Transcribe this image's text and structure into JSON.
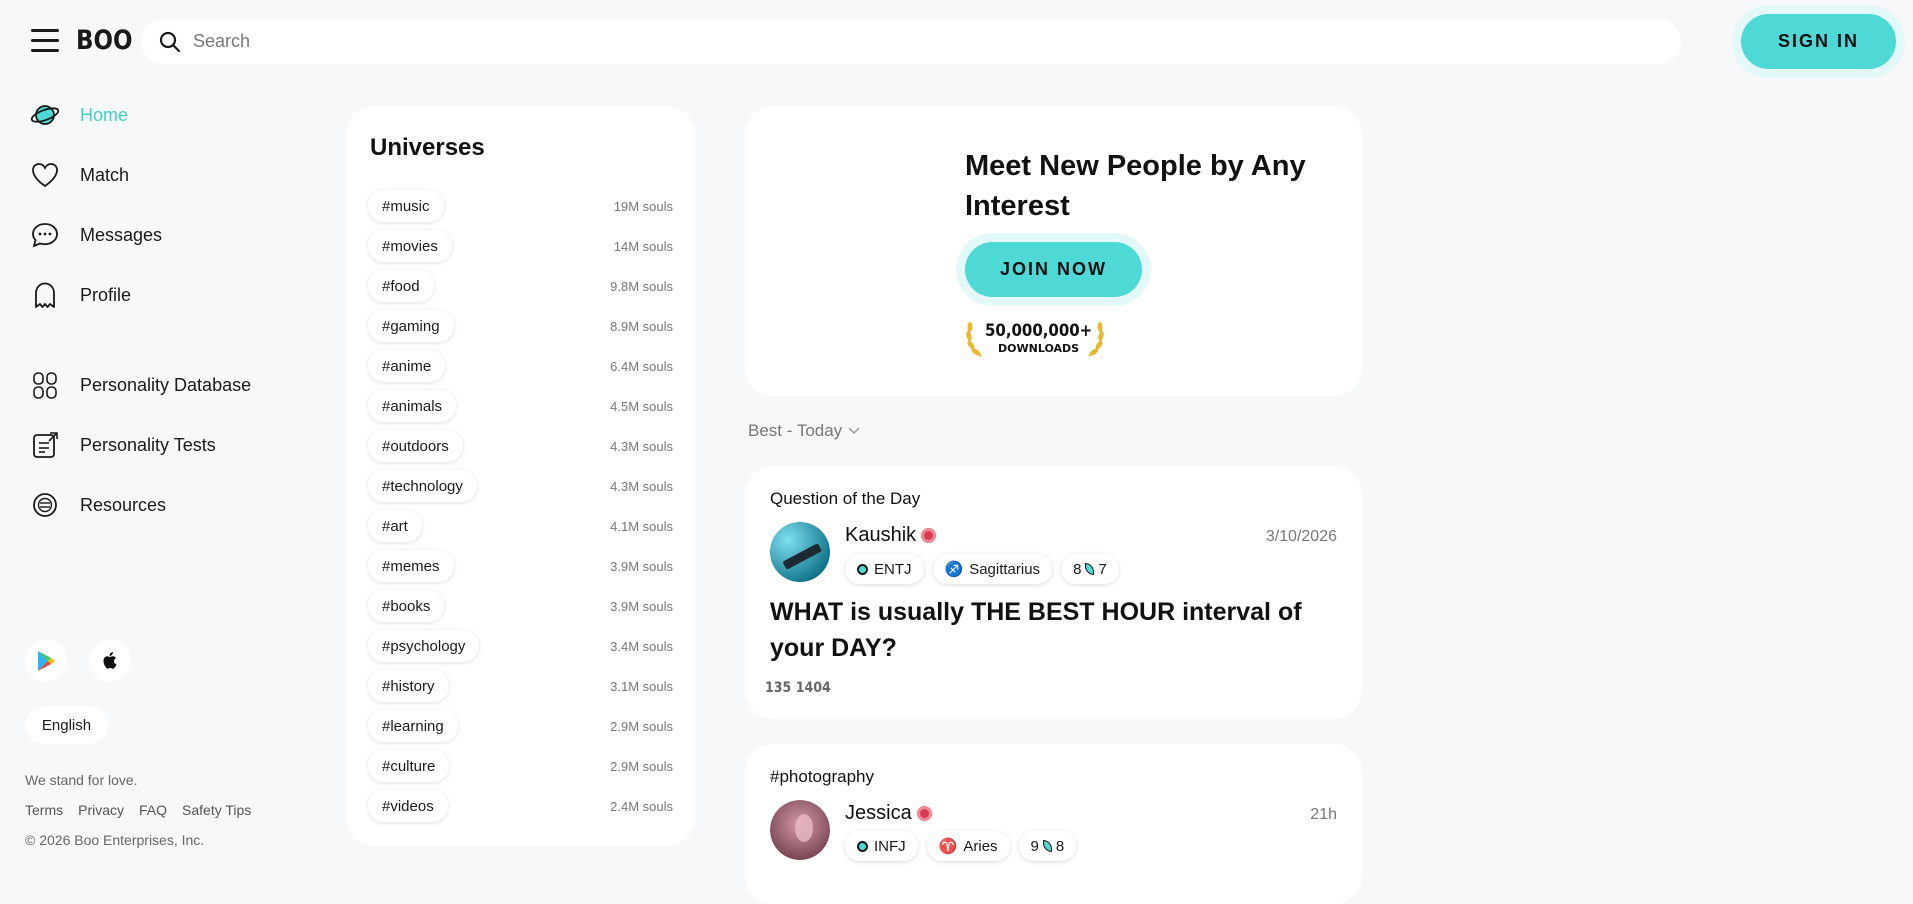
{
  "header": {
    "logo": "BOO",
    "search_placeholder": "Search",
    "sign_in_label": "SIGN IN"
  },
  "nav": {
    "items": [
      {
        "label": "Home",
        "icon": "planet-icon",
        "active": true
      },
      {
        "label": "Match",
        "icon": "heart-icon"
      },
      {
        "label": "Messages",
        "icon": "chat-bubble-icon"
      },
      {
        "label": "Profile",
        "icon": "ghost-icon"
      },
      {
        "label": "Personality Database",
        "icon": "database-grid-icon"
      },
      {
        "label": "Personality Tests",
        "icon": "test-sheet-icon"
      },
      {
        "label": "Resources",
        "icon": "resources-icon"
      }
    ]
  },
  "footer": {
    "language": "English",
    "tagline": "We stand for love.",
    "links": [
      "Terms",
      "Privacy",
      "FAQ",
      "Safety Tips"
    ],
    "copyright": "© 2026 Boo Enterprises, Inc."
  },
  "universes": {
    "title": "Universes",
    "items": [
      {
        "tag": "#music",
        "souls": "19M souls"
      },
      {
        "tag": "#movies",
        "souls": "14M souls"
      },
      {
        "tag": "#food",
        "souls": "9.8M souls"
      },
      {
        "tag": "#gaming",
        "souls": "8.9M souls"
      },
      {
        "tag": "#anime",
        "souls": "6.4M souls"
      },
      {
        "tag": "#animals",
        "souls": "4.5M souls"
      },
      {
        "tag": "#outdoors",
        "souls": "4.3M souls"
      },
      {
        "tag": "#technology",
        "souls": "4.3M souls"
      },
      {
        "tag": "#art",
        "souls": "4.1M souls"
      },
      {
        "tag": "#memes",
        "souls": "3.9M souls"
      },
      {
        "tag": "#books",
        "souls": "3.9M souls"
      },
      {
        "tag": "#psychology",
        "souls": "3.4M souls"
      },
      {
        "tag": "#history",
        "souls": "3.1M souls"
      },
      {
        "tag": "#learning",
        "souls": "2.9M souls"
      },
      {
        "tag": "#culture",
        "souls": "2.9M souls"
      },
      {
        "tag": "#videos",
        "souls": "2.4M souls"
      }
    ]
  },
  "promo": {
    "headline": "Meet New People by Any Interest",
    "join_label": "JOIN NOW",
    "downloads_count": "50,000,000+",
    "downloads_label": "DOWNLOADS"
  },
  "feed": {
    "sort_label": "Best - Today",
    "posts": [
      {
        "header": "Question of the Day",
        "user": "Kaushik",
        "date": "3/10/2026",
        "mbti": "ENTJ",
        "zodiac": "Sagittarius",
        "zodiac_icon": "♐",
        "karma_left": "8",
        "karma_right": "7",
        "question": "WHAT is usually THE BEST HOUR interval of your DAY?",
        "counts": "135 1404"
      },
      {
        "header": "#photography",
        "user": "Jessica",
        "date": "21h",
        "mbti": "INFJ",
        "zodiac": "Aries",
        "zodiac_icon": "♈",
        "karma_left": "9",
        "karma_right": "8"
      }
    ]
  },
  "colors": {
    "accent": "#4fd9d6",
    "accent_glow": "#e3f8f8",
    "background": "#f7f8f9",
    "active_nav": "#3fcfcc"
  }
}
